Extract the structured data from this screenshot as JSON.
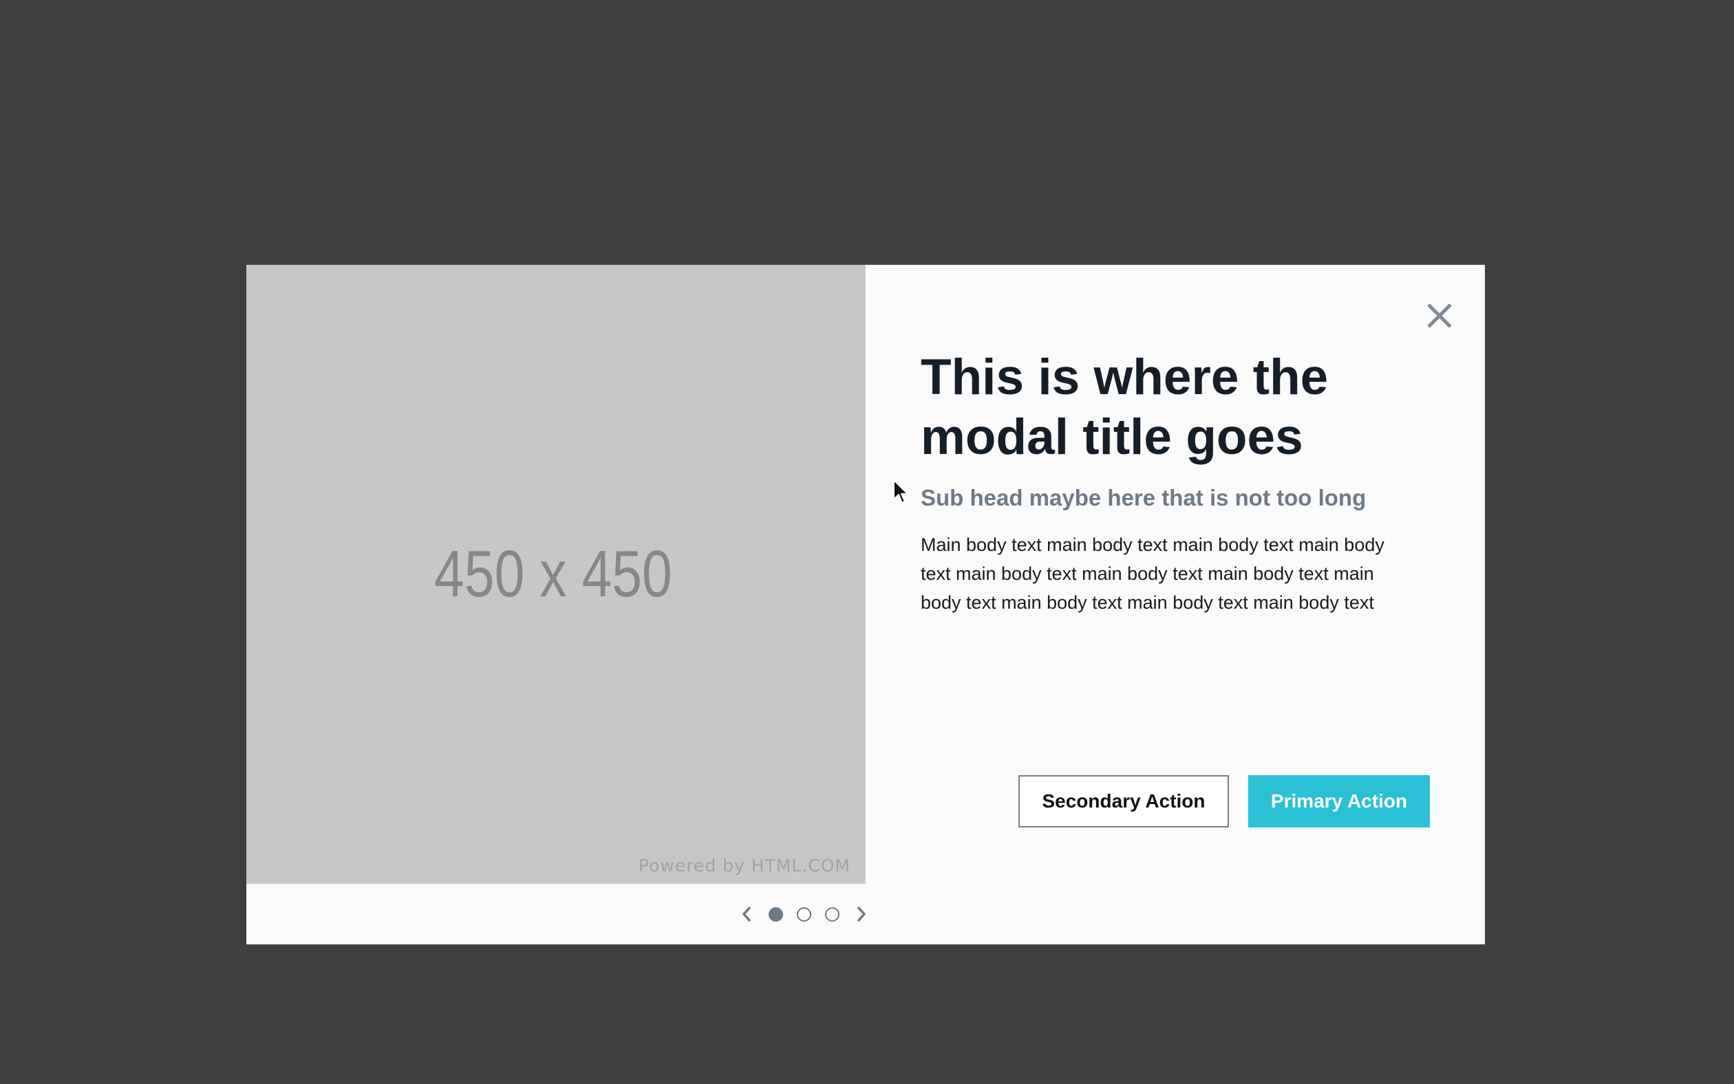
{
  "image_panel": {
    "placeholder_text": "450 x 450",
    "powered_by": "Powered by HTML.COM"
  },
  "modal": {
    "close_icon": "close-icon",
    "title": "This is where the modal title goes",
    "subhead": "Sub head maybe here that is not too long",
    "body": "Main body text main body text main body text main body text main body text main body text main body text main body text main body text main body text main body text",
    "secondary_action": "Secondary Action",
    "primary_action": "Primary Action"
  },
  "pager": {
    "prev_icon": "chevron-left-icon",
    "next_icon": "chevron-right-icon",
    "pages": [
      {
        "active": true
      },
      {
        "active": false
      },
      {
        "active": false
      }
    ]
  },
  "colors": {
    "backdrop": "#3f3f3f",
    "modal_bg": "#fafafa",
    "image_bg": "#c7c7c7",
    "title": "#161e28",
    "subhead": "#6e7a86",
    "primary": "#2cc0d6",
    "dot": "#6e7a86"
  }
}
